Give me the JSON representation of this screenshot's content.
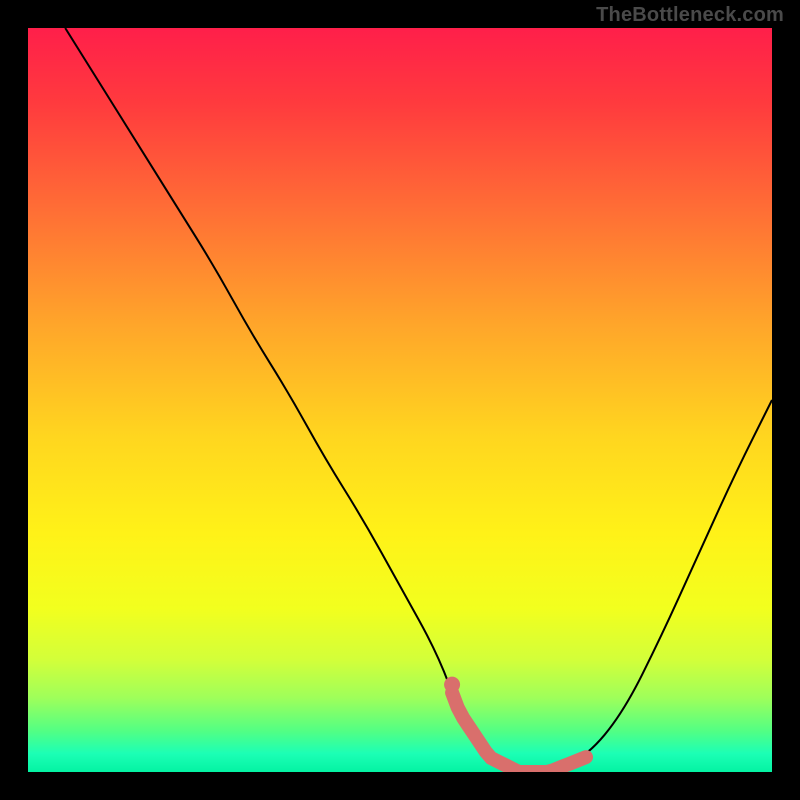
{
  "watermark": "TheBottleneck.com",
  "colors": {
    "frame": "#000000",
    "watermark_text": "#4a4a4a",
    "curve_stroke": "#000000",
    "highlight": "#d96f6c",
    "gradient_stops": [
      {
        "offset": 0.0,
        "color": "#ff1f4a"
      },
      {
        "offset": 0.1,
        "color": "#ff3a3e"
      },
      {
        "offset": 0.25,
        "color": "#ff7035"
      },
      {
        "offset": 0.4,
        "color": "#ffa62a"
      },
      {
        "offset": 0.55,
        "color": "#ffd61f"
      },
      {
        "offset": 0.68,
        "color": "#fff218"
      },
      {
        "offset": 0.78,
        "color": "#f2ff1e"
      },
      {
        "offset": 0.85,
        "color": "#d2ff3a"
      },
      {
        "offset": 0.9,
        "color": "#9fff5a"
      },
      {
        "offset": 0.945,
        "color": "#52ff84"
      },
      {
        "offset": 0.975,
        "color": "#1cffb5"
      },
      {
        "offset": 1.0,
        "color": "#04f3a3"
      }
    ]
  },
  "chart_data": {
    "type": "line",
    "title": "",
    "xlabel": "",
    "ylabel": "",
    "xlim": [
      0,
      100
    ],
    "ylim": [
      0,
      100
    ],
    "x": [
      5,
      10,
      15,
      20,
      25,
      30,
      35,
      40,
      45,
      50,
      55,
      58,
      62,
      66,
      70,
      75,
      80,
      85,
      90,
      95,
      100
    ],
    "values": [
      100,
      92,
      84,
      76,
      68,
      59,
      51,
      42,
      34,
      25,
      16,
      8,
      2,
      0,
      0,
      2,
      8,
      18,
      29,
      40,
      50
    ],
    "highlight_range_x": [
      57,
      75
    ],
    "note": "x is normalized horizontal position (0=left edge of plot, 100=right). values is the approximate height of the black V-shaped curve above the bottom edge, in percent of plot height. highlight_range_x marks the pink/salmon thick segment spanning the valley floor."
  }
}
